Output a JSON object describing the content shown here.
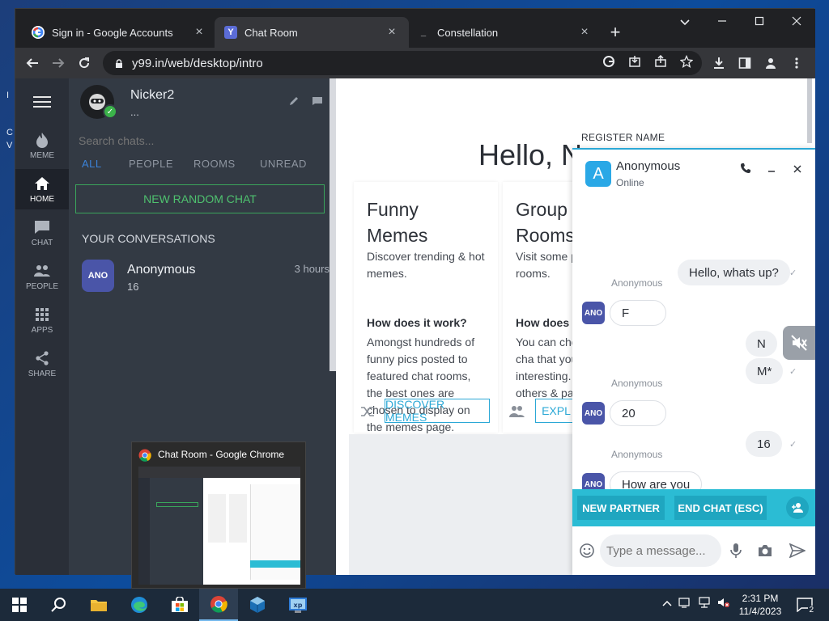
{
  "browser": {
    "tabs": [
      {
        "title": "Sign in - Google Accounts",
        "favicon": "google-icon"
      },
      {
        "title": "Chat Room",
        "favicon": "y99-icon"
      },
      {
        "title": "Constellation",
        "favicon": "terminal-icon"
      }
    ],
    "close_glyph": "×",
    "newtab_glyph": "+",
    "url": "y99.in/web/desktop/intro"
  },
  "leftnav": {
    "items": [
      {
        "label": "MEME",
        "icon": "flame-icon"
      },
      {
        "label": "HOME",
        "icon": "home-icon"
      },
      {
        "label": "CHAT",
        "icon": "chat-icon"
      },
      {
        "label": "PEOPLE",
        "icon": "people-icon"
      },
      {
        "label": "APPS",
        "icon": "apps-grid-icon"
      },
      {
        "label": "SHARE",
        "icon": "share-icon"
      }
    ]
  },
  "chatpanel": {
    "username": "Nicker2",
    "status": "...",
    "search_placeholder": "Search chats...",
    "filters": [
      "ALL",
      "PEOPLE",
      "ROOMS",
      "UNREAD"
    ],
    "new_chat_label": "NEW RANDOM CHAT",
    "conversations_title": "YOUR CONVERSATIONS",
    "conversations": [
      {
        "avatar": "ANO",
        "name": "Anonymous",
        "sub": "16",
        "time": "3 hours"
      }
    ]
  },
  "content": {
    "greeting": "Hello, N",
    "cards": [
      {
        "title_line1": "Funny",
        "title_line2": "Memes",
        "desc": "Discover trending & hot memes.",
        "question": "How does it work?",
        "body": "Amongst hundreds of funny pics posted to featured chat rooms, the best ones are chosen to display on the memes page.",
        "button": "DISCOVER MEMES"
      },
      {
        "title_line1": "Group",
        "title_line2": "Rooms",
        "desc": "Visit some p chat rooms.",
        "question": "How does i",
        "body": "You can cho featured cha that you fin interesting. yourself, ge others & pa discussion.",
        "button": "EXPL"
      }
    ]
  },
  "popup": {
    "register_label": "REGISTER NAME",
    "avatar": "A",
    "name": "Anonymous",
    "status": "Online",
    "messages": [
      {
        "dir": "out",
        "text": "Hello, whats up?"
      },
      {
        "dir": "in",
        "sender": "Anonymous",
        "avatar": "ANO",
        "text": "F"
      },
      {
        "dir": "out",
        "text": "N"
      },
      {
        "dir": "out",
        "text": "M*"
      },
      {
        "dir": "in",
        "sender": "Anonymous",
        "avatar": "ANO",
        "text": "20"
      },
      {
        "dir": "out",
        "text": "16"
      },
      {
        "dir": "in",
        "sender": "Anonymous",
        "avatar": "ANO",
        "text": "How are you"
      }
    ],
    "new_partner_label": "NEW PARTNER",
    "end_chat_label": "END CHAT (ESC)",
    "input_placeholder": "Type a message..."
  },
  "thumbnail": {
    "title": "Chat Room - Google Chrome"
  },
  "taskbar": {
    "apps": [
      "start-icon",
      "search-icon",
      "file-explorer-icon",
      "edge-icon",
      "store-icon",
      "chrome-icon",
      "virtualbox-icon",
      "xp-icon"
    ],
    "time": "2:31 PM",
    "date": "11/4/2023",
    "notifications": "2"
  },
  "colors": {
    "accent": "#2bbcd4",
    "green": "#3aa55b",
    "panel": "#333a44",
    "nav": "#2a2f38"
  }
}
